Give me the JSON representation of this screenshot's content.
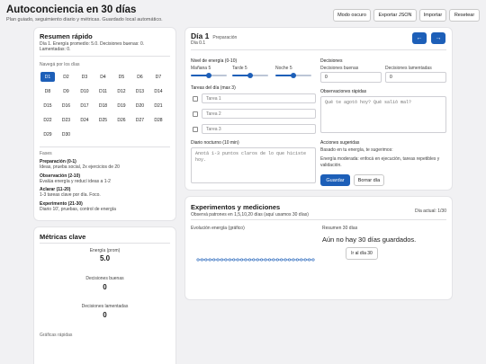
{
  "header": {
    "title": "Autoconciencia en 30 días",
    "subtitle": "Plan guiado, seguimiento diario y métricas. Guardado local automático.",
    "buttons": {
      "dark_mode": "Modo oscuro",
      "export_json": "Exportar JSON",
      "import": "Importar",
      "reset": "Resetear"
    }
  },
  "summary": {
    "title": "Resumen rápido",
    "line1": "Día 1. Energía promedio: 5.0. Decisiones buenas: 0.",
    "line2": "Lamentadas: 0."
  },
  "nav": {
    "label": "Navegá por los días",
    "days": [
      "D1",
      "D2",
      "D3",
      "D4",
      "D5",
      "D6",
      "D7",
      "D8",
      "D9",
      "D10",
      "D11",
      "D12",
      "D13",
      "D14",
      "D15",
      "D16",
      "D17",
      "D18",
      "D19",
      "D20",
      "D21",
      "D22",
      "D23",
      "D24",
      "D25",
      "D26",
      "D27",
      "D28",
      "D29",
      "D30"
    ],
    "active_day": "D1"
  },
  "phases": {
    "label": "Fases",
    "items": [
      {
        "name": "Preparación (0-1)",
        "desc": "Ideas, prueba social, 2x ejercicios de 20"
      },
      {
        "name": "Observación (2-10)",
        "desc": "Evalúa energía y reducí ideas a 1-2"
      },
      {
        "name": "Aclarar (11-20)",
        "desc": "1-3 tareas clave por día. Foco."
      },
      {
        "name": "Experimento (21-30)",
        "desc": "Diario 10', pruebas, control de energía"
      }
    ]
  },
  "metrics": {
    "title": "Métricas clave",
    "energy_label": "Energía (prom)",
    "energy_value": "5.0",
    "good_label": "Decisiones buenas",
    "good_value": "0",
    "regret_label": "Decisiones lamentadas",
    "regret_value": "0",
    "quick_charts_label": "Gráficas rápidas"
  },
  "day_panel": {
    "title": "Día 1",
    "phase": "Preparación",
    "subtitle": "Día 0.1",
    "prev_icon": "←",
    "next_icon": "→",
    "energy": {
      "label": "Nivel de energía (0-10)",
      "morning_label": "Mañana 5",
      "afternoon_label": "Tarde 5",
      "night_label": "Noche 5",
      "morning_value": 5,
      "afternoon_value": 5,
      "night_value": 5,
      "max": 10
    },
    "tasks": {
      "label": "Tareas del día (max 3)",
      "placeholders": [
        "Tarea 1",
        "Tarea 2",
        "Tarea 3"
      ]
    },
    "journal": {
      "label": "Diario nocturno (10 min)",
      "placeholder": "Anotá 1-3 puntos claros de lo que hiciste hoy."
    },
    "decisions": {
      "label": "Decisiones",
      "good_label": "Decisiones buenas",
      "good_value": "0",
      "regret_label": "Decisiones lamentadas",
      "regret_value": "0"
    },
    "notes": {
      "label": "Observaciones rápidas",
      "placeholder": "Qué te agotó hoy? Qué salió mal?"
    },
    "suggested": {
      "label": "Acciones sugeridas",
      "line1": "Basado en tu energía, te sugerimos:",
      "line2": "Energía moderada: enfocá en ejecución, tareas repetibles y validación."
    },
    "save_label": "Guardar",
    "clear_label": "Borrar día"
  },
  "experiments": {
    "title": "Experimentos y mediciones",
    "subtitle": "Observá patrones en 1,5,10,20 días (aquí usamos 30 días)",
    "current_day": "Día actual: 1/30",
    "chart_label": "Evolución energía (gráfico)",
    "summary_label": "Resumen 30 días",
    "summary_text": "Aún no hay 30 días guardados.",
    "goto_label": "Ir al día 30"
  },
  "chart_data": {
    "type": "line",
    "title": "Evolución energía (gráfico)",
    "x": [
      1,
      2,
      3,
      4,
      5,
      6,
      7,
      8,
      9,
      10,
      11,
      12,
      13,
      14,
      15,
      16,
      17,
      18,
      19,
      20,
      21,
      22,
      23,
      24,
      25,
      26,
      27,
      28,
      29,
      30
    ],
    "values": [
      5,
      5,
      5,
      5,
      5,
      5,
      5,
      5,
      5,
      5,
      5,
      5,
      5,
      5,
      5,
      5,
      5,
      5,
      5,
      5,
      5,
      5,
      5,
      5,
      5,
      5,
      5,
      5,
      5,
      5
    ],
    "ylim": [
      0,
      10
    ],
    "color": "#1d5fb8"
  }
}
